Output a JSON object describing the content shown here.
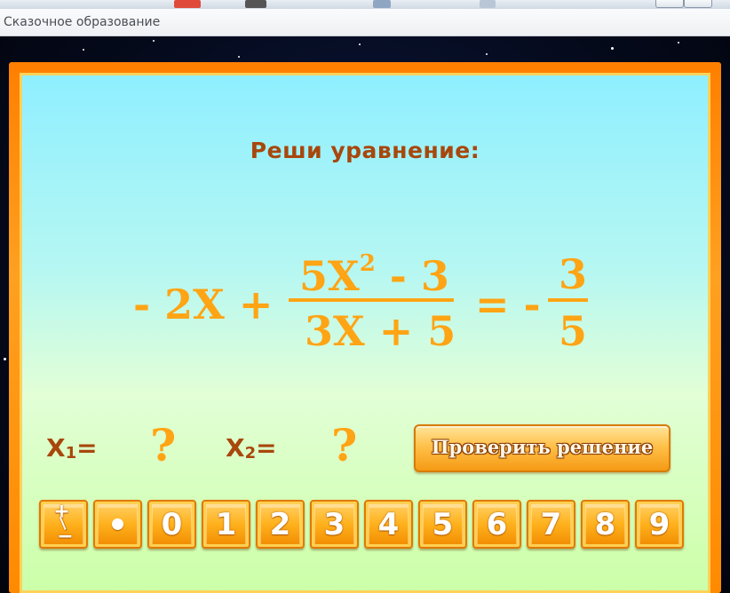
{
  "app": {
    "title": "Сказочное образование"
  },
  "task": {
    "prompt": "Реши уравнение:"
  },
  "equation": {
    "t1": "- 2X +",
    "num": "5X",
    "exp": "2",
    "num_rest": " - 3",
    "den": "3X + 5",
    "eq": "= -",
    "rhs_num": "3",
    "rhs_den": "5"
  },
  "answers": {
    "x1_label": "X",
    "x1_sub": "1",
    "x1_eq": "=",
    "x1_value": "?",
    "x2_label": "X",
    "x2_sub": "2",
    "x2_eq": "=",
    "x2_value": "?"
  },
  "buttons": {
    "check": "Проверить решение"
  },
  "keypad": {
    "plusminus_top": "+",
    "plusminus_bottom": "−",
    "digits": [
      "0",
      "1",
      "2",
      "3",
      "4",
      "5",
      "6",
      "7",
      "8",
      "9"
    ]
  },
  "colors": {
    "accent": "#ffa414",
    "label": "#a8470c",
    "frame": "#ff8a00"
  }
}
